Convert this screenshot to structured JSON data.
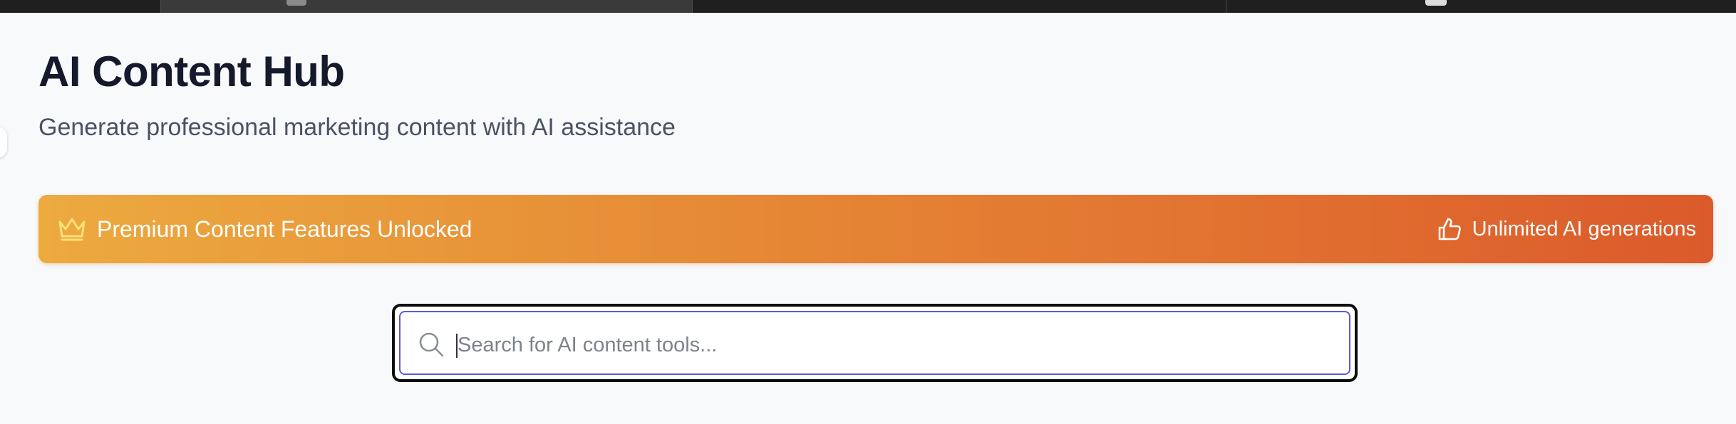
{
  "header": {
    "title": "AI Content Hub",
    "subtitle": "Generate professional marketing content with AI assistance"
  },
  "banner": {
    "icon": "crown-icon",
    "title": "Premium Content Features Unlocked",
    "perk_icon": "thumbs-up-icon",
    "perk": "Unlimited AI generations",
    "gradient": [
      "#ecaa3f",
      "#db5a2b"
    ]
  },
  "search": {
    "icon": "search-icon",
    "placeholder": "Search for AI content tools...",
    "value": "",
    "focus_color": "#5b5bd6"
  }
}
